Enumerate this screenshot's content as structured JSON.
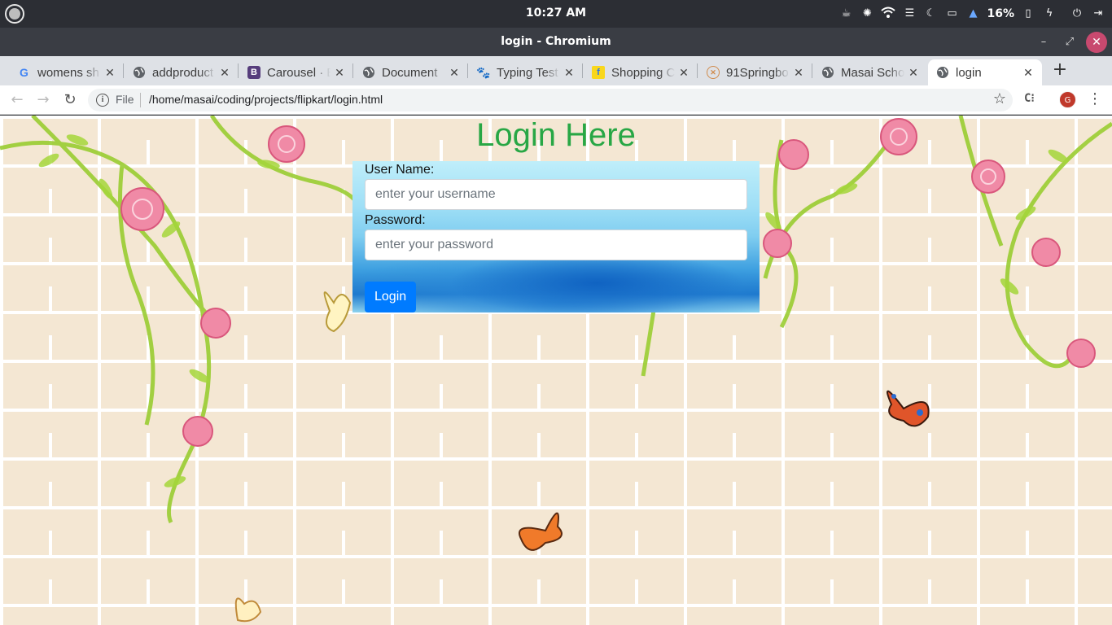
{
  "system_bar": {
    "clock": "10:27 AM",
    "battery_percent": "16%"
  },
  "window": {
    "title": "login - Chromium"
  },
  "tabs": [
    {
      "label": "womens sh",
      "favicon": "google-icon",
      "active": false
    },
    {
      "label": "addproduct",
      "favicon": "globe-icon",
      "active": false
    },
    {
      "label": "Carousel · B",
      "favicon": "bootstrap-icon",
      "active": false
    },
    {
      "label": "Document",
      "favicon": "globe-icon",
      "active": false
    },
    {
      "label": "Typing Test",
      "favicon": "paw-icon",
      "active": false
    },
    {
      "label": "Shopping C",
      "favicon": "flipkart-icon",
      "active": false
    },
    {
      "label": "91Springbo",
      "favicon": "springboard-icon",
      "active": false
    },
    {
      "label": "Masai Scho",
      "favicon": "globe-icon",
      "active": false
    },
    {
      "label": "login",
      "favicon": "globe-icon",
      "active": true
    }
  ],
  "address_bar": {
    "scheme_label": "File",
    "url": "/home/masai/coding/projects/flipkart/login.html"
  },
  "profile": {
    "avatar_letter": "G",
    "color": "#c0392b"
  },
  "page": {
    "title": "Login Here",
    "title_color": "#28a745",
    "username_label": "User Name:",
    "username_placeholder": "enter your username",
    "password_label": "Password:",
    "password_placeholder": "enter your password",
    "login_button": "Login",
    "button_color": "#007bff"
  }
}
